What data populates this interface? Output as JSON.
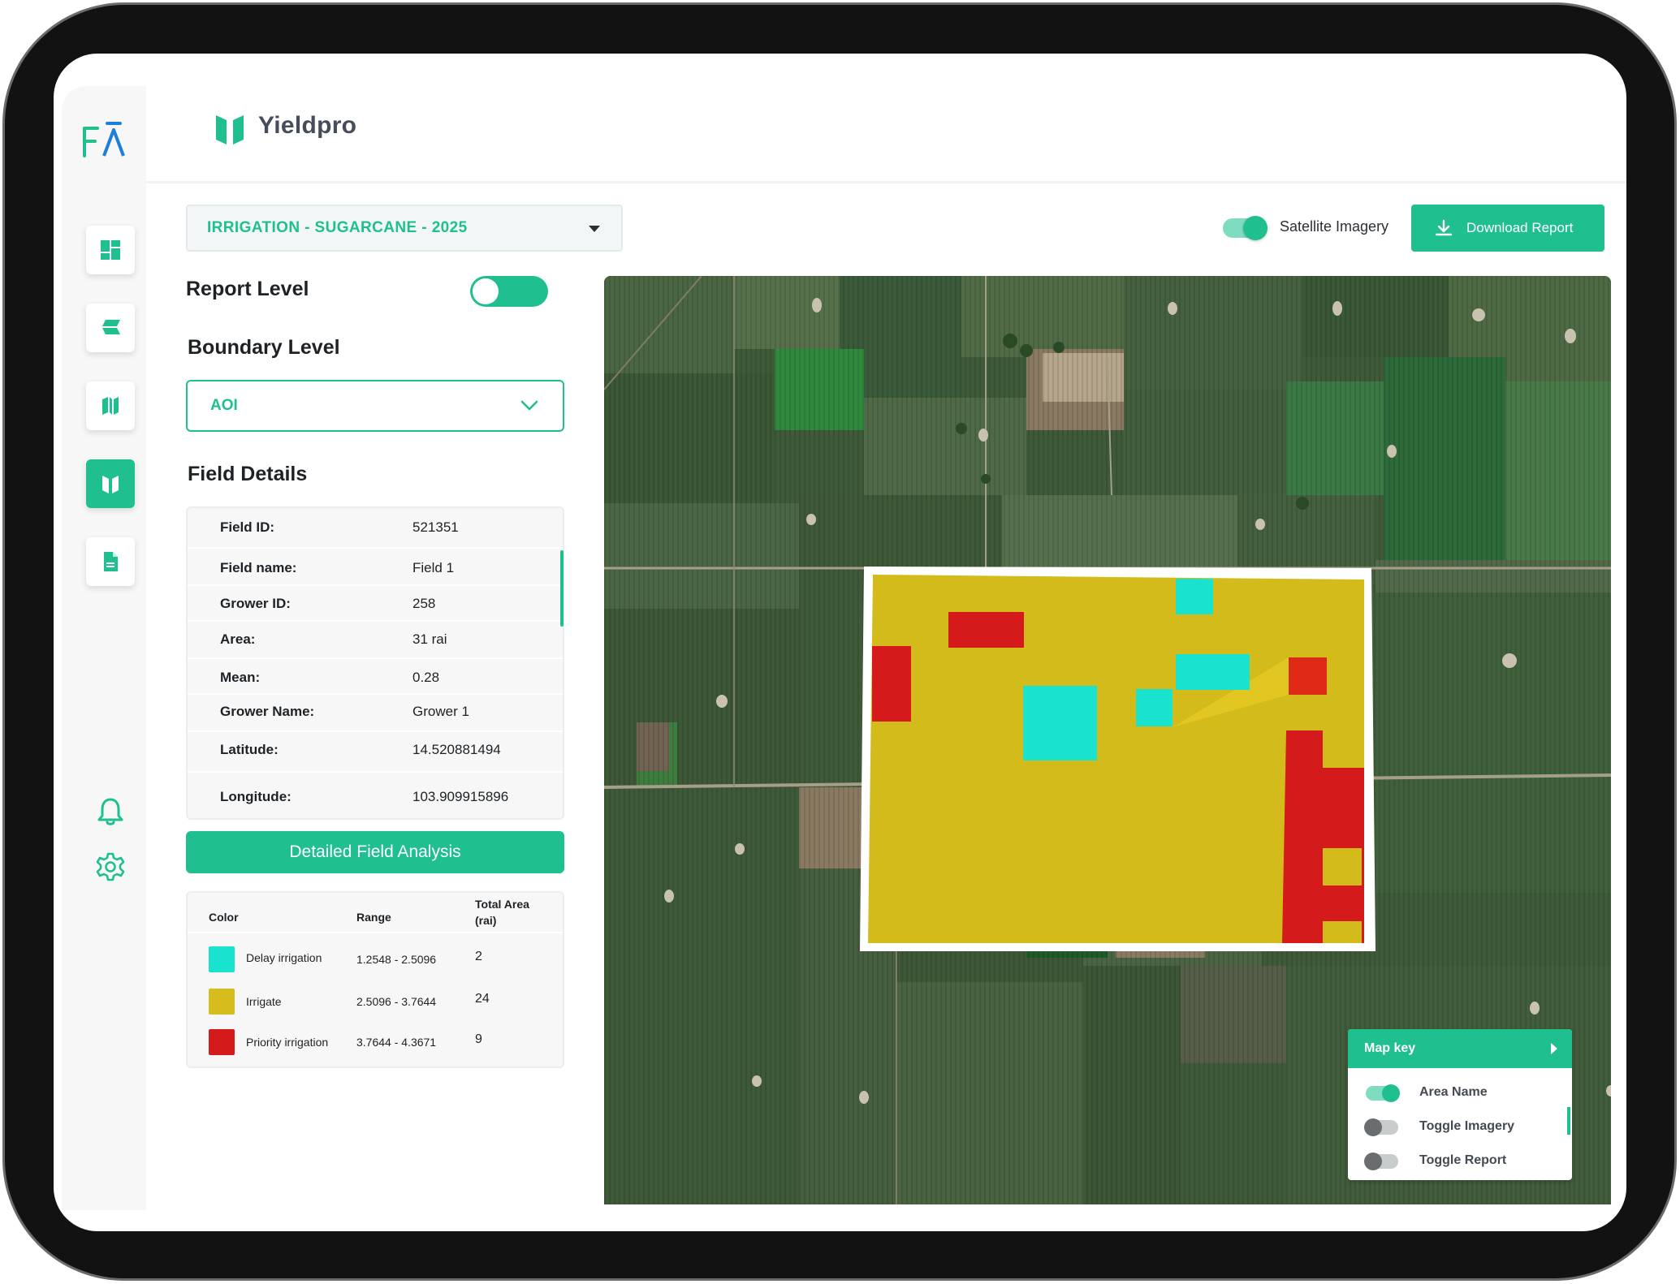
{
  "app": {
    "rail_logo": "FĀ",
    "brand_name": "Yieldpro"
  },
  "rail": {
    "items": [
      {
        "icon": "dashboard-icon",
        "active": false
      },
      {
        "icon": "layers-icon",
        "active": false
      },
      {
        "icon": "map-icon",
        "active": false
      },
      {
        "icon": "yieldpro-icon",
        "active": true
      },
      {
        "icon": "document-icon",
        "active": false
      }
    ],
    "bottom_icons": [
      "bell-icon",
      "gear-icon"
    ]
  },
  "toolbar": {
    "project_label": "IRRIGATION - SUGARCANE - 2025",
    "satellite_label": "Satellite Imagery",
    "satellite_on": true,
    "download_label": "Download Report"
  },
  "panel": {
    "report_level_label": "Report Level",
    "report_level_on": true,
    "boundary_level_label": "Boundary Level",
    "boundary_value": "AOI",
    "field_details_title": "Field Details",
    "details": [
      {
        "key": "Field ID:",
        "value": "521351"
      },
      {
        "key": "Field name:",
        "value": "Field 1"
      },
      {
        "key": "Grower ID:",
        "value": "258"
      },
      {
        "key": "Area:",
        "value": "31 rai"
      },
      {
        "key": "Mean:",
        "value": "0.28"
      },
      {
        "key": "Grower Name:",
        "value": "Grower 1"
      },
      {
        "key": "Latitude:",
        "value": "14.520881494"
      },
      {
        "key": "Longitude:",
        "value": "103.909915896"
      }
    ],
    "analysis_button": "Detailed Field Analysis"
  },
  "legend": {
    "headers": {
      "color": "Color",
      "range": "Range",
      "area_line1": "Total Area",
      "area_line2": "(rai)"
    },
    "rows": [
      {
        "name": "Delay irrigation",
        "range": "1.2548 - 2.5096",
        "area": "2",
        "color": "#19e3cf"
      },
      {
        "name": "Irrigate",
        "range": "2.5096 - 3.7644",
        "area": "24",
        "color": "#d6bc1c"
      },
      {
        "name": "Priority irrigation",
        "range": "3.7644 - 4.3671",
        "area": "9",
        "color": "#d41a1a"
      }
    ]
  },
  "map_key": {
    "title": "Map key",
    "items": [
      {
        "label": "Area Name",
        "on": true
      },
      {
        "label": "Toggle Imagery",
        "on": false
      },
      {
        "label": "Toggle Report",
        "on": false
      }
    ]
  },
  "colors": {
    "accent": "#1fbf8f",
    "delay": "#19e3cf",
    "irrigate": "#d6bc1c",
    "priority": "#d41a1a"
  }
}
